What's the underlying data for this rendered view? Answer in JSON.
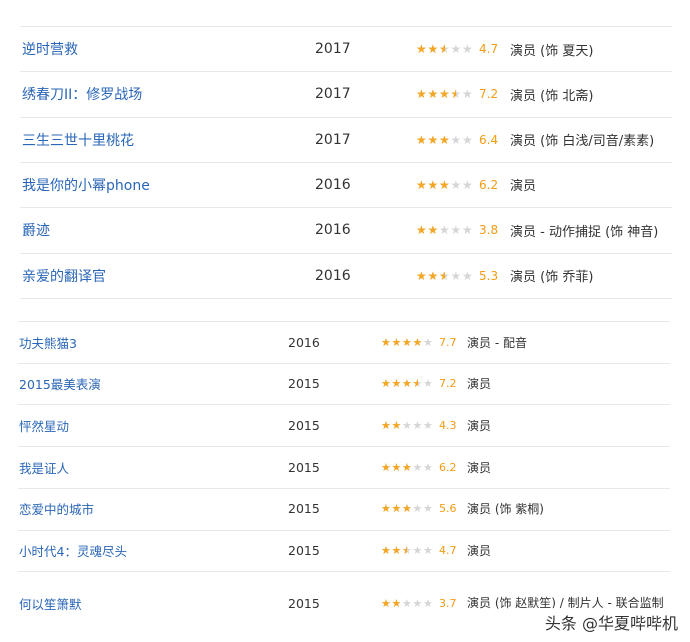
{
  "filmography_top": [
    {
      "title": "逆时营救",
      "year": "2017",
      "rating": 4.7,
      "role": "演员 (饰 夏天)"
    },
    {
      "title": "绣春刀II：修罗战场",
      "year": "2017",
      "rating": 7.2,
      "role": "演员 (饰 北斋)"
    },
    {
      "title": "三生三世十里桃花",
      "year": "2017",
      "rating": 6.4,
      "role": "演员 (饰 白浅/司音/素素)"
    },
    {
      "title": "我是你的小幂phone",
      "year": "2016",
      "rating": 6.2,
      "role": "演员"
    },
    {
      "title": "爵迹",
      "year": "2016",
      "rating": 3.8,
      "role": "演员 - 动作捕捉 (饰 神音)"
    },
    {
      "title": "亲爱的翻译官",
      "year": "2016",
      "rating": 5.3,
      "role": "演员 (饰 乔菲)"
    }
  ],
  "filmography_bottom": [
    {
      "title": "功夫熊猫3",
      "year": "2016",
      "rating": 7.7,
      "role": "演员 - 配音"
    },
    {
      "title": "2015最美表演",
      "year": "2015",
      "rating": 7.2,
      "role": "演员"
    },
    {
      "title": "怦然星动",
      "year": "2015",
      "rating": 4.3,
      "role": "演员"
    },
    {
      "title": "我是证人",
      "year": "2015",
      "rating": 6.2,
      "role": "演员"
    },
    {
      "title": "恋爱中的城市",
      "year": "2015",
      "rating": 5.6,
      "role": "演员 (饰 紫桐)"
    },
    {
      "title": "小时代4：灵魂尽头",
      "year": "2015",
      "rating": 4.7,
      "role": "演员"
    },
    {
      "title": "何以笙箫默",
      "year": "2015",
      "rating": 3.7,
      "role": "演员 (饰 赵默笙) / 制片人 - 联合监制"
    }
  ],
  "watermark": "头条 @华夏哔哔机",
  "colors": {
    "title_link": "#2a66b7",
    "star_filled": "#f5a623",
    "star_empty": "#d6d6d6",
    "score": "#f39c12"
  }
}
